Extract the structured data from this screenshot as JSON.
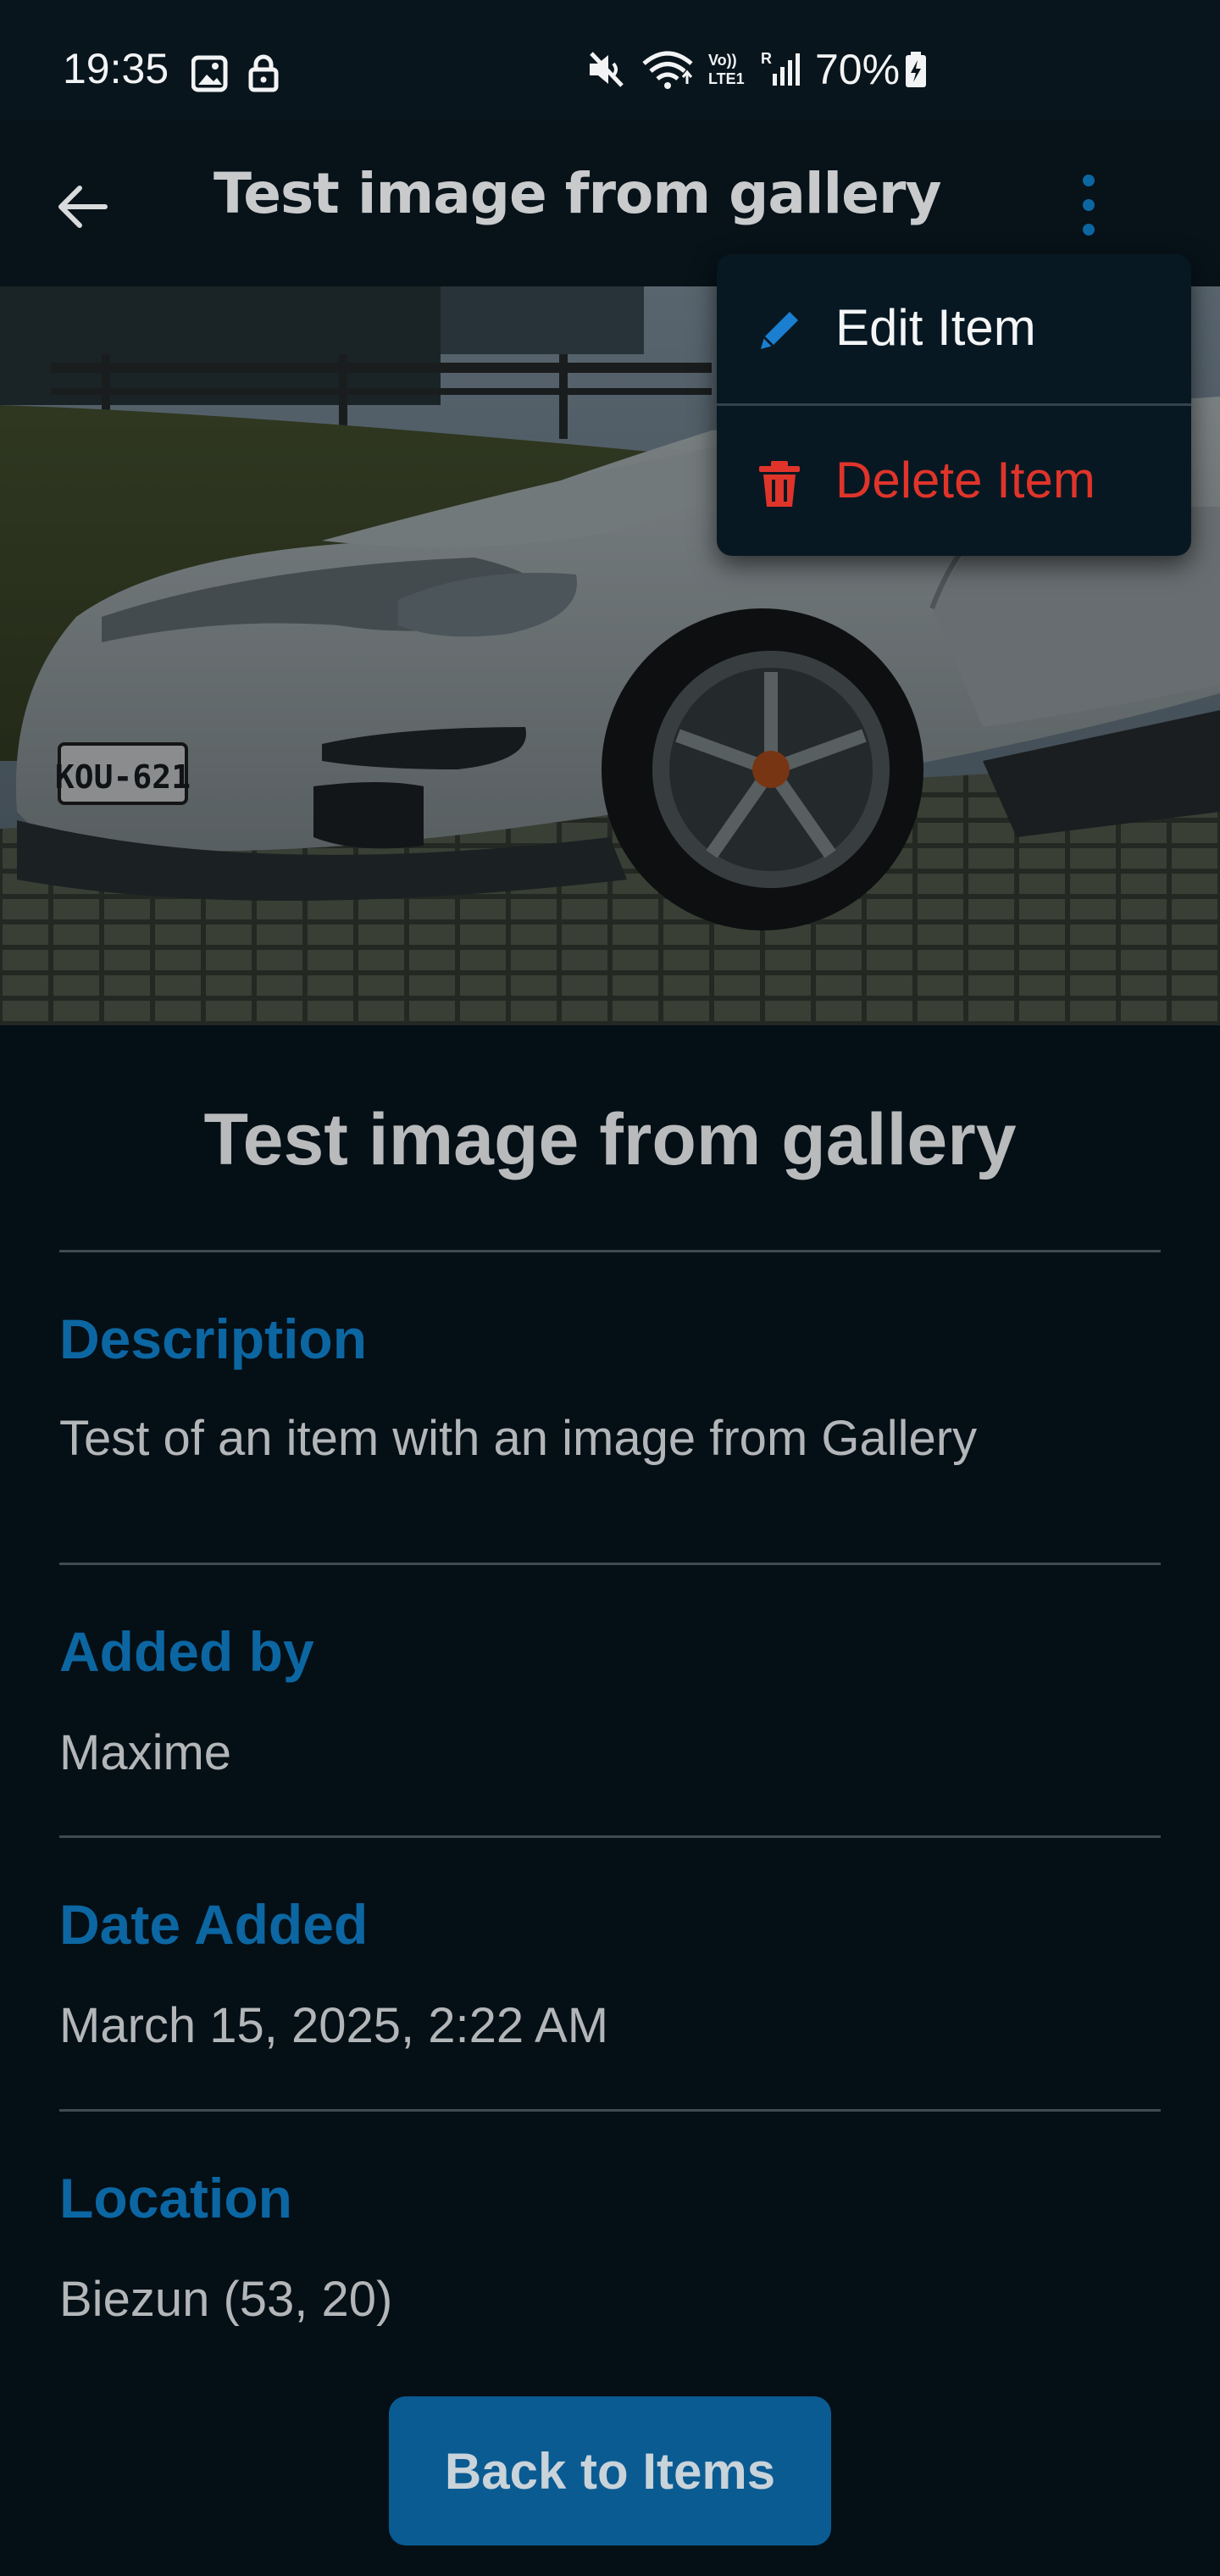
{
  "status_bar": {
    "time": "19:35",
    "battery": "70%",
    "icons": [
      "image-icon",
      "lock-icon",
      "mute-icon",
      "wifi-icon",
      "volte-icon",
      "signal-icon",
      "battery-charging-icon"
    ],
    "volte_label": "Vo))",
    "lte_label": "LTE1",
    "roaming_label": "R"
  },
  "app_bar": {
    "title": "Test image from gallery",
    "back_icon": "arrow-left-icon",
    "menu_icon": "more-vertical-icon"
  },
  "hero": {
    "plate_text": "KOU-621"
  },
  "menu": {
    "items": [
      {
        "label": "Edit Item",
        "icon": "pencil-icon",
        "color": "#f4f5f6",
        "icon_color": "#1a7fd0"
      },
      {
        "label": "Delete Item",
        "icon": "trash-icon",
        "color": "#e0342b",
        "icon_color": "#e0342b"
      }
    ]
  },
  "item": {
    "title": "Test image from gallery",
    "sections": [
      {
        "label": "Description",
        "value": "Test of an item with an image from Gallery"
      },
      {
        "label": "Added by",
        "value": "Maxime"
      },
      {
        "label": "Date Added",
        "value": "March 15, 2025, 2:22 AM"
      },
      {
        "label": "Location",
        "value": "Biezun (53, 20)"
      }
    ]
  },
  "actions": {
    "back_to_items": "Back to Items"
  },
  "colors": {
    "background": "#050f16",
    "accent": "#0c66a2",
    "danger": "#e0342b",
    "button": "#0a5b92"
  }
}
